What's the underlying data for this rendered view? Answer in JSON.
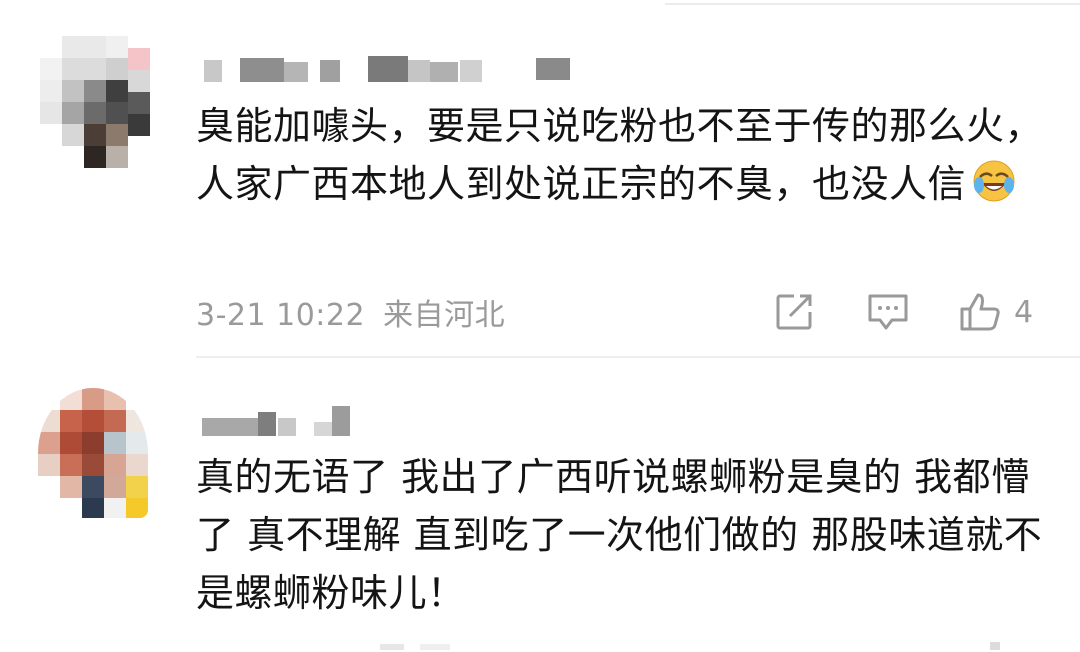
{
  "comments": [
    {
      "text": "臭能加噱头，要是只说吃粉也不至于传的那么火，人家广西本地人到处说正宗的不臭，也没人信",
      "emoji": "laughing-crying-emoji",
      "time": "3-21 10:22",
      "location": "来自河北",
      "like_count": "4"
    },
    {
      "text": "真的无语了 我出了广西听说螺蛳粉是臭的 我都懵了 真不理解 直到吃了一次他们做的 那股味道就不是螺蛳粉味儿！"
    }
  ],
  "icons": [
    "share-icon",
    "comment-icon",
    "like-icon"
  ],
  "colors": {
    "text": "#141414",
    "meta": "#9a9a9a",
    "divider": "#efefef"
  }
}
